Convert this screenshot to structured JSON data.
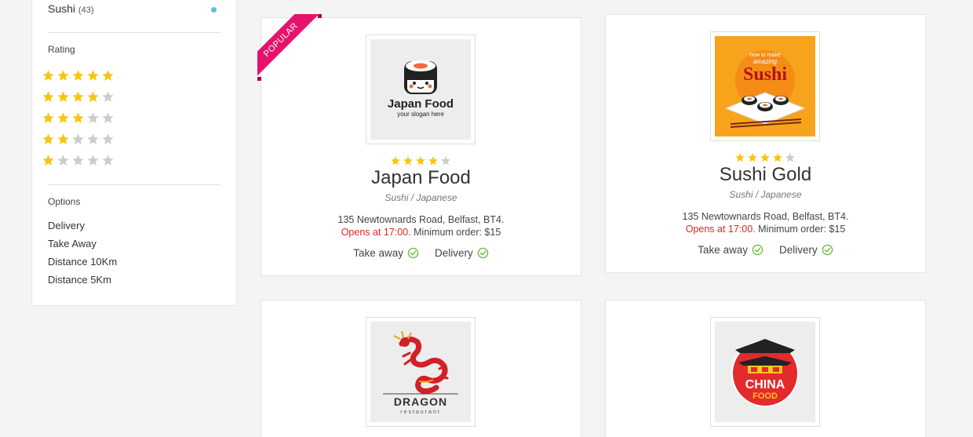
{
  "sidebar": {
    "category": {
      "label": "Sushi",
      "count": "(43)"
    },
    "rating_heading": "Rating",
    "ratings": [
      5,
      4,
      3,
      2,
      1
    ],
    "options_heading": "Options",
    "options": [
      "Delivery",
      "Take Away",
      "Distance 10Km",
      "Distance 5Km"
    ]
  },
  "colors": {
    "star_on": "#f7c511",
    "star_off": "#cccccc",
    "accent": "#e5136b",
    "check": "#6cc04a",
    "dot": "#5bc0de"
  },
  "cards": [
    {
      "ribbon": "POPULAR",
      "logo_icon": "japan-food-logo",
      "logo_text": "Japan Food",
      "logo_slogan": "your slogan here",
      "rating": 4,
      "title": "Japan Food",
      "cuisine": "Sushi / Japanese",
      "address": "135 Newtownards Road, Belfast, BT4.",
      "opens": "Opens at 17:00.",
      "minimum": "Minimum order: $15",
      "option1": "Take away",
      "option2": "Delivery"
    },
    {
      "logo_icon": "sushi-gold-logo",
      "logo_text_small1": "how to make",
      "logo_text_small2": "amazing",
      "logo_text": "Sushi",
      "rating": 4,
      "title": "Sushi Gold",
      "cuisine": "Sushi / Japanese",
      "address": "135 Newtownards Road, Belfast, BT4.",
      "opens": "Opens at 17:00.",
      "minimum": "Minimum order: $15",
      "option1": "Take away",
      "option2": "Delivery"
    },
    {
      "logo_icon": "dragon-logo",
      "logo_text": "DRAGON",
      "logo_slogan": "restaurant"
    },
    {
      "logo_icon": "china-food-logo",
      "logo_text": "CHINA",
      "logo_slogan": "FOOD"
    }
  ]
}
